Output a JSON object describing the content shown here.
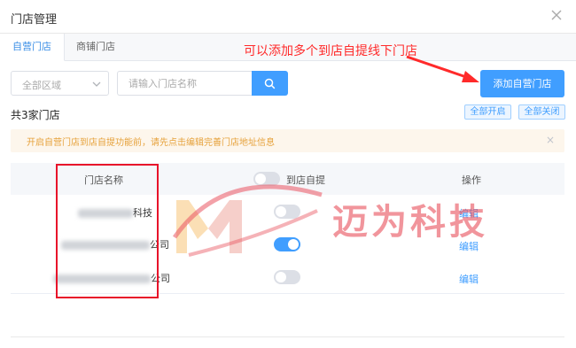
{
  "modal": {
    "title": "门店管理"
  },
  "tabs": [
    {
      "label": "自营门店",
      "active": true
    },
    {
      "label": "商铺门店",
      "active": false
    }
  ],
  "annotation": {
    "text": "可以添加多个到店自提线下门店",
    "color": "#ff2a2a"
  },
  "filters": {
    "region_placeholder": "全部区域",
    "search_placeholder": "请输入门店名称"
  },
  "add_button": {
    "label": "添加自营门店"
  },
  "summary": {
    "count_text": "共3家门店",
    "enable_all": "全部开启",
    "disable_all": "全部关闭"
  },
  "alert": {
    "text": "开启自营门店到店自提功能前，请先点击编辑完善门店地址信息"
  },
  "table": {
    "columns": [
      "门店名称",
      "到店自提",
      "操作"
    ],
    "header_pickup_toggle": false,
    "rows": [
      {
        "name_visible": "科技",
        "pickup_enabled": false,
        "action": "编辑"
      },
      {
        "name_visible": "公司",
        "pickup_enabled": true,
        "action": "编辑"
      },
      {
        "name_visible": "公司",
        "pickup_enabled": false,
        "action": "编辑"
      }
    ]
  },
  "watermark": {
    "text": "迈为科技"
  },
  "colors": {
    "primary": "#409eff",
    "annotation": "#ff2a2a",
    "alert_bg": "#fdf6ec",
    "alert_text": "#e6a23c"
  },
  "icons": [
    "close-icon",
    "chevron-down-icon",
    "search-icon",
    "arrow-right-icon"
  ]
}
